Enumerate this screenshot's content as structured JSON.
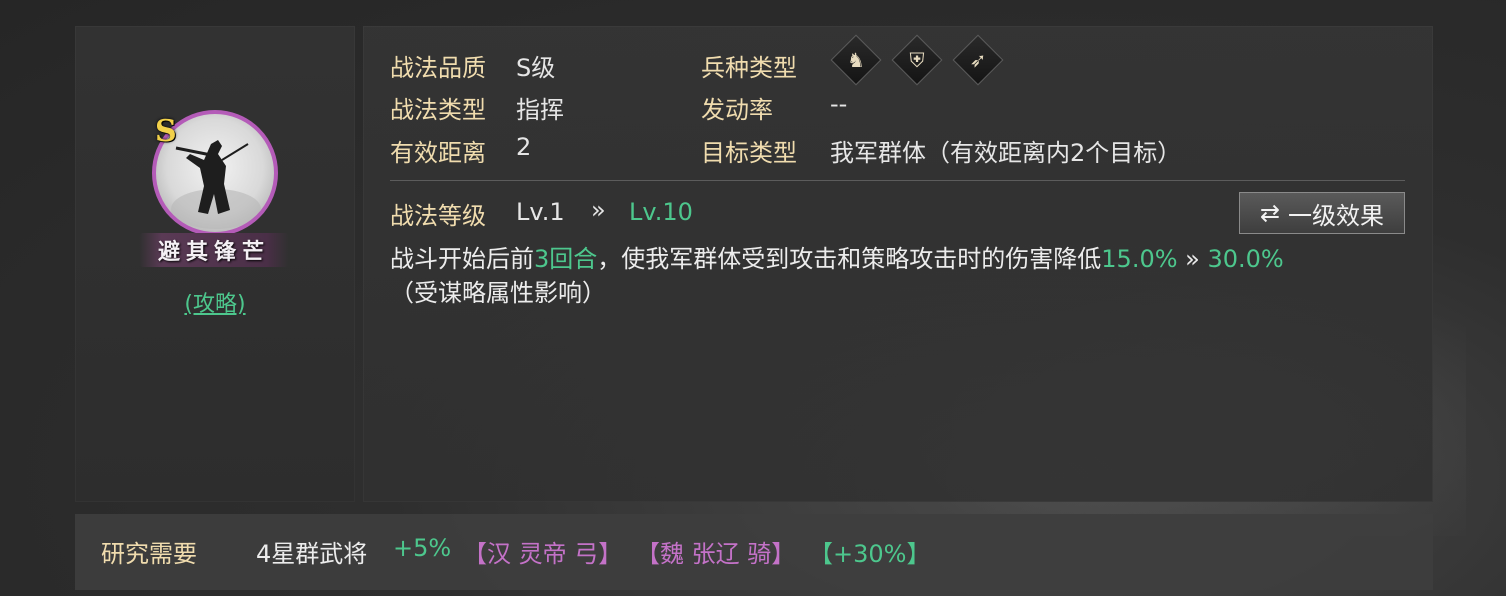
{
  "skill": {
    "grade": "S",
    "name": "避其锋芒",
    "kind": "(攻略)"
  },
  "attributes": {
    "quality_label": "战法品质",
    "quality_value": "S级",
    "type_label": "战法类型",
    "type_value": "指挥",
    "range_label": "有效距离",
    "range_value": "2",
    "troop_label": "兵种类型",
    "troop_icons": [
      "cavalry-icon",
      "shield-icon",
      "bow-icon"
    ],
    "rate_label": "发动率",
    "rate_value": "--",
    "target_label": "目标类型",
    "target_value": "我军群体（有效距离内2个目标）"
  },
  "level": {
    "label": "战法等级",
    "current": "Lv.1",
    "arrow": "»",
    "max": "Lv.10",
    "toggle_label": "一级效果"
  },
  "description": {
    "part1": "战斗开始后前",
    "rounds": "3回合",
    "part2": "，使我军群体受到攻击和策略攻击时的伤害降低",
    "from_pct": "15.0%",
    "arrow": " » ",
    "to_pct": "30.0%",
    "note": "（受谋略属性影响）"
  },
  "research": {
    "label": "研究需要",
    "text": "4星群武将",
    "bonus": "+5%",
    "hero1": "【汉 灵帝 弓】",
    "hero2": "【魏 张辽 骑】",
    "pct": "【+30%】"
  },
  "colors": {
    "accent_green": "#4dc78d",
    "label_gold": "#f0dcae",
    "hero_purple": "#c472c8",
    "portrait_border": "#b45bb8"
  }
}
